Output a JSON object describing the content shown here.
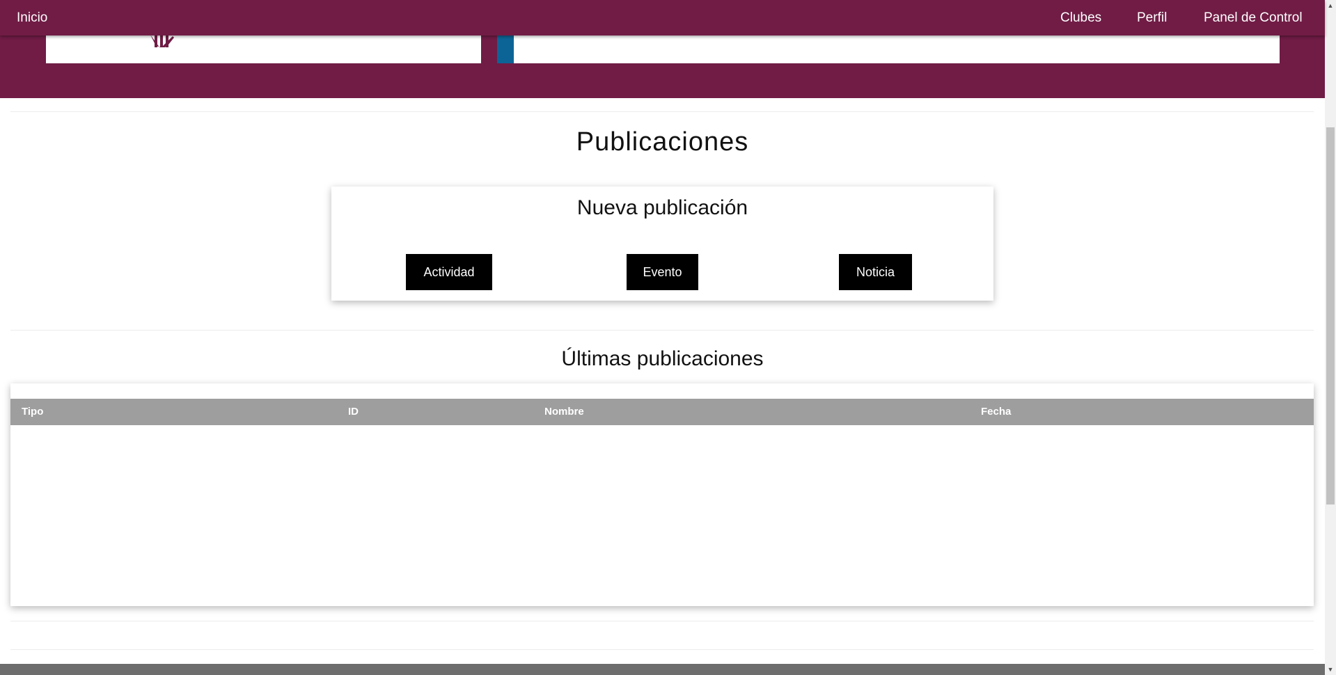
{
  "nav": {
    "home": "Inicio",
    "clubs": "Clubes",
    "profile": "Perfil",
    "dashboard": "Panel de Control"
  },
  "page": {
    "title": "Publicaciones"
  },
  "new_publication": {
    "heading": "Nueva publicación",
    "buttons": {
      "activity": "Actividad",
      "event": "Evento",
      "news": "Noticia"
    }
  },
  "latest": {
    "heading": "Últimas publicaciones",
    "columns": {
      "type": "Tipo",
      "id": "ID",
      "name": "Nombre",
      "date": "Fecha"
    },
    "rows": []
  },
  "colors": {
    "brand_maroon": "#701c45",
    "accent_blue": "#0c6496",
    "table_header": "#9e9e9e",
    "button": "#000000"
  }
}
